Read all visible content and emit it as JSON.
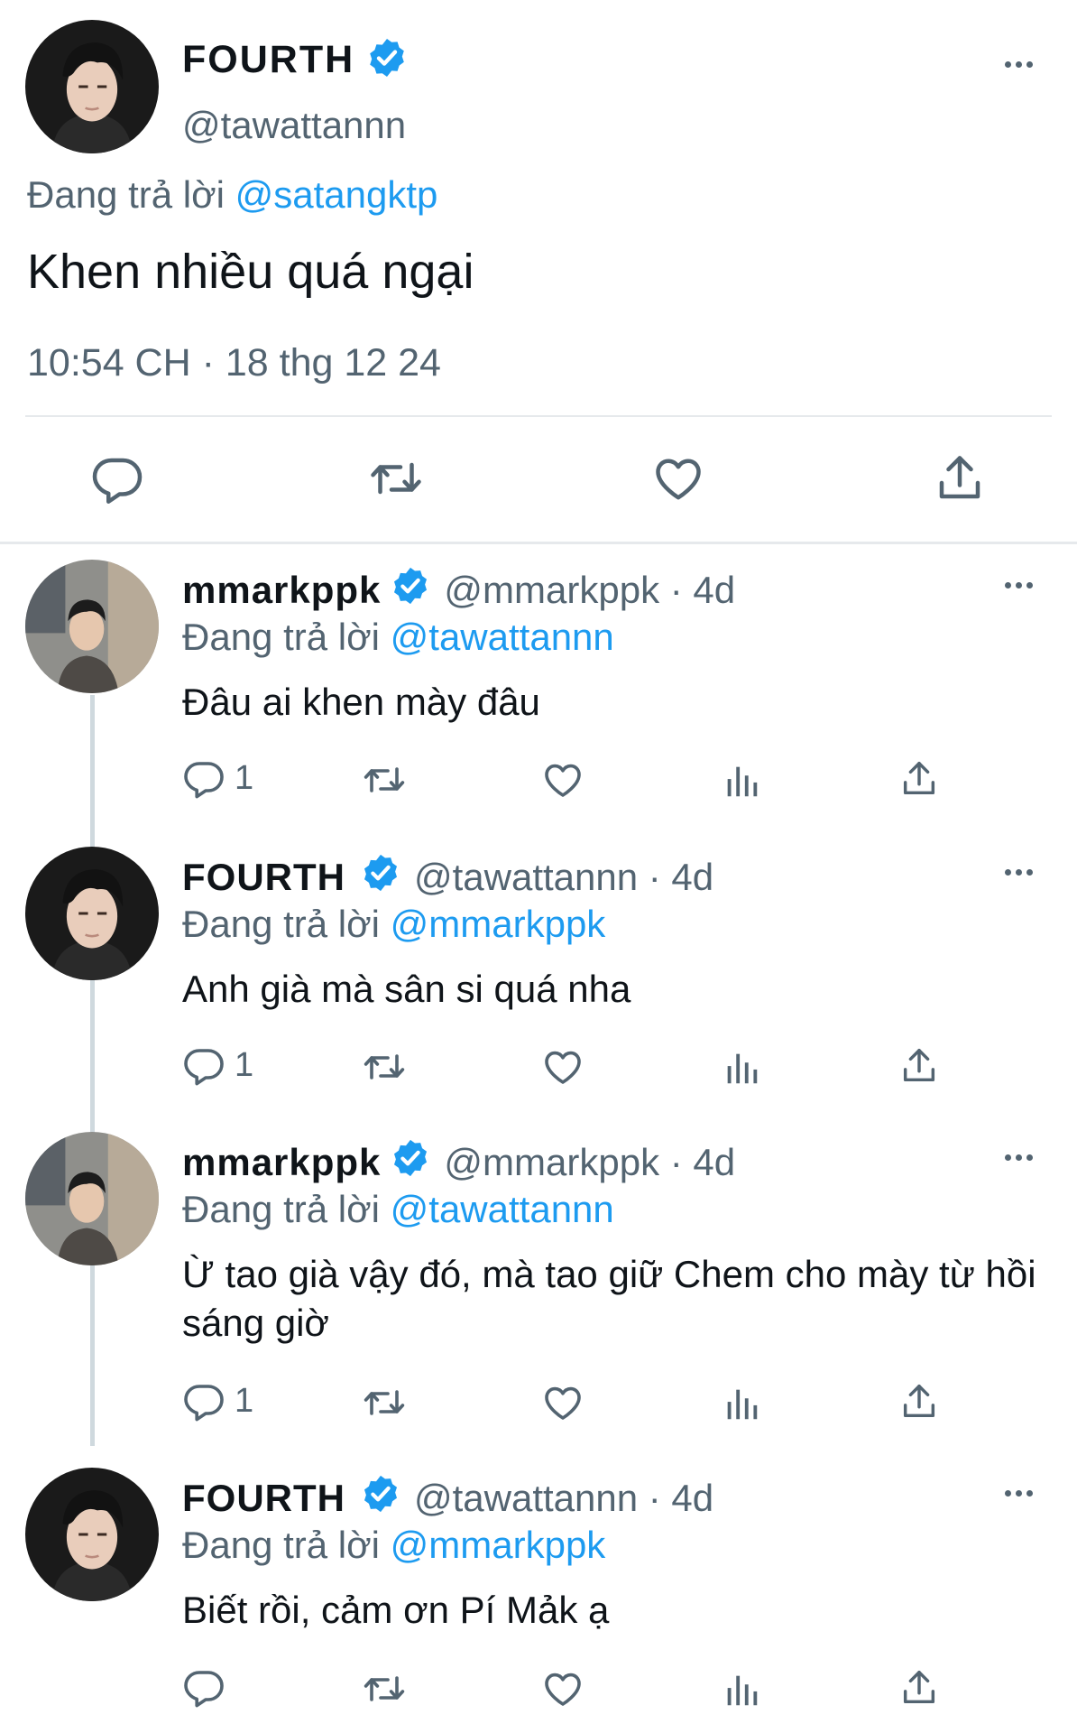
{
  "main_tweet": {
    "name": "FOURTH",
    "handle": "@tawattannn",
    "reply_prefix": "Đang trả lời",
    "reply_to": "@satangktp",
    "text": "Khen nhiều quá ngại",
    "timestamp": "10:54 CH · 18 thg 12 24"
  },
  "replies": [
    {
      "name": "mmarkppk",
      "handle": "@mmarkppk · 4d",
      "reply_prefix": "Đang trả lời",
      "reply_to": "@tawattannn",
      "text": "Đâu ai khen mày đâu",
      "reply_count": "1"
    },
    {
      "name": "FOURTH",
      "handle": "@tawattannn · 4d",
      "reply_prefix": "Đang trả lời",
      "reply_to": "@mmarkppk",
      "text": "Anh già mà sân si quá nha",
      "reply_count": "1"
    },
    {
      "name": "mmarkppk",
      "handle": "@mmarkppk · 4d",
      "reply_prefix": "Đang trả lời",
      "reply_to": "@tawattannn",
      "text": "Ừ tao già vậy đó, mà tao giữ Chem cho mày từ hồi sáng giờ",
      "reply_count": "1"
    },
    {
      "name": "FOURTH",
      "handle": "@tawattannn · 4d",
      "reply_prefix": "Đang trả lời",
      "reply_to": "@mmarkppk",
      "text": "Biết rồi, cảm ơn Pí Mảk ạ",
      "reply_count": ""
    }
  ],
  "colors": {
    "accent": "#1d9bf0",
    "muted": "#536471",
    "text": "#0f1419",
    "divider": "#e6e9ec",
    "thread_line": "#cfd9de"
  },
  "icons": [
    "reply-icon",
    "retweet-icon",
    "like-icon",
    "views-icon",
    "share-icon",
    "more-icon",
    "verified-badge-icon"
  ]
}
